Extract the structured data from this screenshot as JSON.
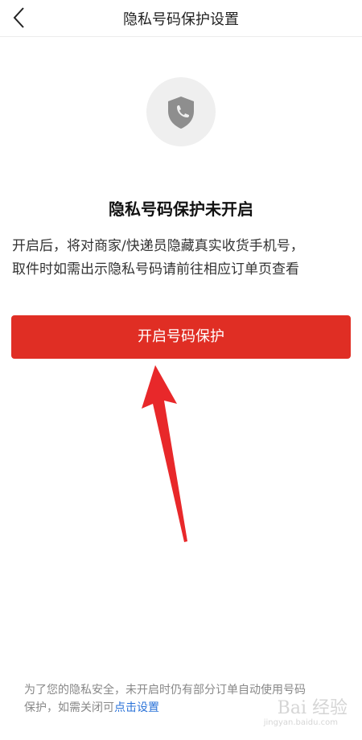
{
  "header": {
    "back_icon": "chevron-left-icon",
    "title": "隐私号码保护设置"
  },
  "status": {
    "icon": "shield-phone-icon",
    "heading": "隐私号码保护未开启",
    "desc_line1": "开启后，将对商家/快递员隐藏真实收货手机号，",
    "desc_line2": "取件时如需出示隐私号码请前往相应订单页查看"
  },
  "action": {
    "enable_label": "开启号码保护",
    "color": "#e02e24"
  },
  "footer": {
    "line1": "为了您的隐私安全，未开启时仍有部分订单自动使用号码",
    "line2_prefix": "保护，如需关闭可",
    "link_label": "点击设置",
    "link_color": "#2a72d8"
  },
  "watermark": {
    "text": "Bai 经验",
    "sub": "jingyan.baidu.com"
  }
}
